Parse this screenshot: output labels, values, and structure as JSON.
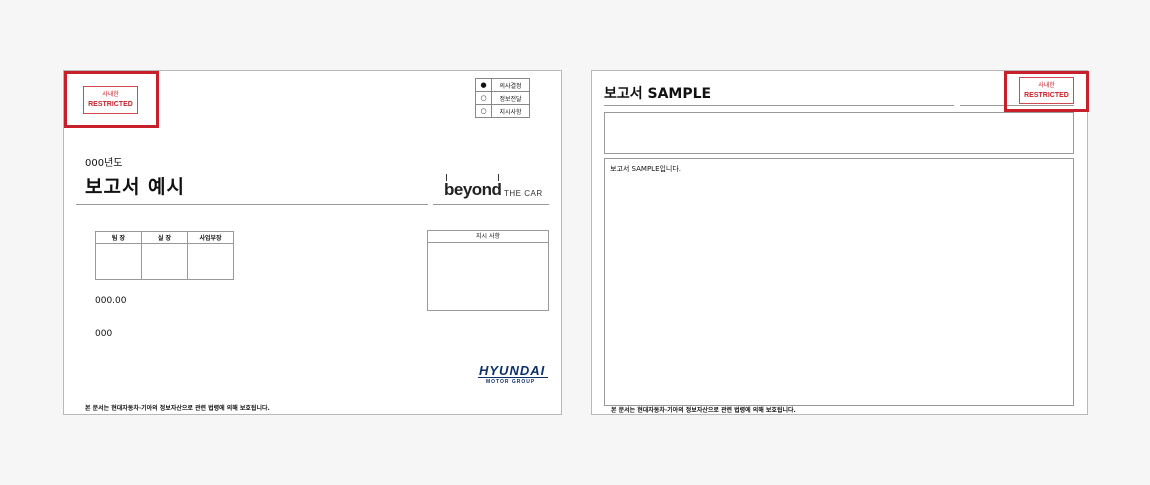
{
  "stamp": {
    "line1": "사내한",
    "line2": "RESTRICTED"
  },
  "cover": {
    "distribution": [
      {
        "bullet": "●",
        "label": "의사결정"
      },
      {
        "bullet": "○",
        "label": "정보전달"
      },
      {
        "bullet": "○",
        "label": "지시사항"
      }
    ],
    "year": "000년도",
    "title": "보고서 예시",
    "logo_word": "beyond",
    "logo_tagline": "THE CAR",
    "approvals": [
      "팀 장",
      "실 장",
      "사업부장"
    ],
    "instruction_header": "지시 사항",
    "date": "000.00",
    "author": "000",
    "footer": "본 문서는 현대자동차·기아의 정보자산으로 관련 법령에 의해 보호됩니다.",
    "brand": "HYUNDAI",
    "brand_sub": "MOTOR GROUP"
  },
  "sample": {
    "title": "보고서 SAMPLE",
    "body": "보고서 SAMPLE입니다.",
    "footer": "본 문서는 현대자동차·기아의 정보자산으로 관련 법령에 의해 보호됩니다."
  }
}
